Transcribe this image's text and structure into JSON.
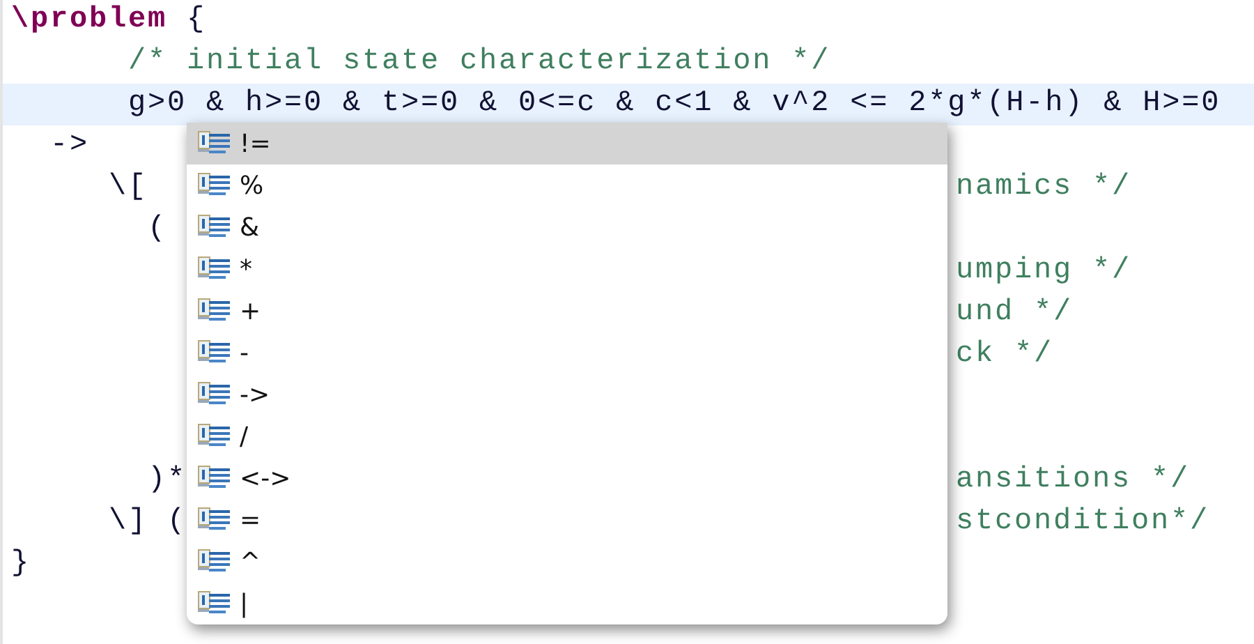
{
  "editor": {
    "lines": [
      {
        "kind": "text",
        "segments": [
          {
            "kind": "keyword",
            "text": "\\problem"
          },
          {
            "kind": "code",
            "text": " {"
          }
        ]
      },
      {
        "kind": "text",
        "segments": [
          {
            "kind": "comment",
            "text": "      /* initial state characterization */"
          }
        ]
      },
      {
        "kind": "text",
        "current": true,
        "segments": [
          {
            "kind": "code",
            "text": "      g>0 & h>=0 & t>=0 & 0<=c & c<1 & v^2 <= 2*g*(H-h) & H>=0"
          }
        ]
      },
      {
        "kind": "split",
        "left": "  ->"
      },
      {
        "kind": "split",
        "left": "     \\[",
        "right": "namics */"
      },
      {
        "kind": "split",
        "left": "       ("
      },
      {
        "kind": "split",
        "right": "umping */"
      },
      {
        "kind": "split",
        "right": "und */"
      },
      {
        "kind": "split",
        "right": "ck */"
      },
      {
        "kind": "covered"
      },
      {
        "kind": "covered"
      },
      {
        "kind": "split",
        "left": "       )*",
        "right": "ansitions */"
      },
      {
        "kind": "split",
        "left": "     \\] (",
        "right": "stcondition*/"
      },
      {
        "kind": "split",
        "left": "}"
      }
    ]
  },
  "completion_popup": {
    "items": [
      {
        "label": "!=",
        "selected": true
      },
      {
        "label": "%",
        "selected": false
      },
      {
        "label": "&",
        "selected": false
      },
      {
        "label": "*",
        "selected": false
      },
      {
        "label": "+",
        "selected": false
      },
      {
        "label": "-",
        "selected": false
      },
      {
        "label": "->",
        "selected": false
      },
      {
        "label": "/",
        "selected": false
      },
      {
        "label": "<->",
        "selected": false
      },
      {
        "label": "=",
        "selected": false
      },
      {
        "label": "^",
        "selected": false
      },
      {
        "label": "|",
        "selected": false
      }
    ]
  }
}
